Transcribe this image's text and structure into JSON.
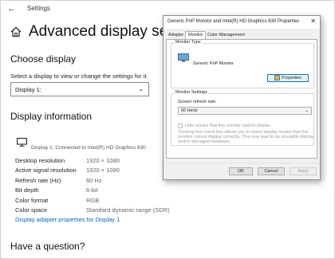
{
  "settings": {
    "app_title": "Settings",
    "page_title": "Advanced display settings",
    "choose_display": {
      "heading": "Choose display",
      "instruction": "Select a display to view or change the settings for it.",
      "selected": "Display 1:"
    },
    "display_info": {
      "heading": "Display information",
      "connection": "Display 1: Connected to Intel(R) HD Graphics 630",
      "rows": [
        {
          "label": "Desktop resolution",
          "value": "1920 × 1080"
        },
        {
          "label": "Active signal resolution",
          "value": "1920 × 1080"
        },
        {
          "label": "Refresh rate (Hz)",
          "value": "60 Hz"
        },
        {
          "label": "Bit depth",
          "value": "6-bit"
        },
        {
          "label": "Color format",
          "value": "RGB"
        },
        {
          "label": "Color space",
          "value": "Standard dynamic range (SDR)"
        }
      ],
      "adapter_link": "Display adapter properties for Display 1"
    },
    "question_heading": "Have a question?"
  },
  "dialog": {
    "title": "Generic PnP Monitor and Intel(R) HD Graphics 630 Properties",
    "close_glyph": "✕",
    "tabs": [
      {
        "label": "Adapter",
        "active": false
      },
      {
        "label": "Monitor",
        "active": true
      },
      {
        "label": "Color Management",
        "active": false
      }
    ],
    "monitor_type": {
      "group_label": "Monitor Type",
      "name": "Generic PnP Monitor",
      "properties_label": "Properties"
    },
    "monitor_settings": {
      "group_label": "Monitor Settings",
      "refresh_label": "Screen refresh rate:",
      "refresh_value": "60 Hertz",
      "hide_modes_label": "Hide modes that this monitor cannot display",
      "hide_modes_help_1": "Clearing this check box allows you to select display modes that this",
      "hide_modes_help_2": "monitor cannot display correctly. This may lead to an unusable display",
      "hide_modes_help_3": "and/or damaged hardware."
    },
    "buttons": {
      "ok": "OK",
      "cancel": "Cancel",
      "apply": "Apply"
    }
  },
  "icons": {
    "back": "←",
    "chevron": "⌄"
  },
  "colors": {
    "link": "#0067c0",
    "focus": "#0078d7"
  }
}
